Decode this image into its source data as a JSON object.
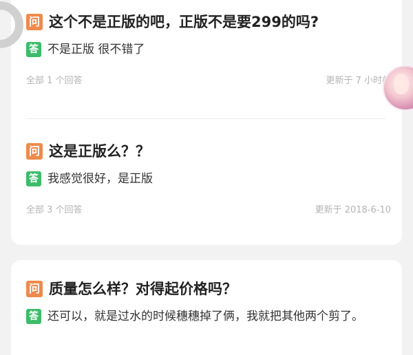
{
  "badges": {
    "question": "问",
    "answer": "答"
  },
  "items": [
    {
      "question": "这个不是正版的吧，正版不是要299的吗?",
      "answer": "不是正版 很不错了",
      "answer_count": "全部 1 个回答",
      "updated": "更新于 7 小时前"
    },
    {
      "question": "这是正版么？？",
      "answer": "我感觉很好，是正版",
      "answer_count": "全部 3 个回答",
      "updated": "更新于 2018-6-10"
    },
    {
      "question": "质量怎么样？对得起价格吗？",
      "answer": "还可以，就是过水的时候穗穗掉了俩，我就把其他两个剪了。"
    }
  ],
  "colors": {
    "question_badge": "#f08a4b",
    "answer_badge": "#3cbc6a",
    "meta_text": "#b3b3b3"
  }
}
